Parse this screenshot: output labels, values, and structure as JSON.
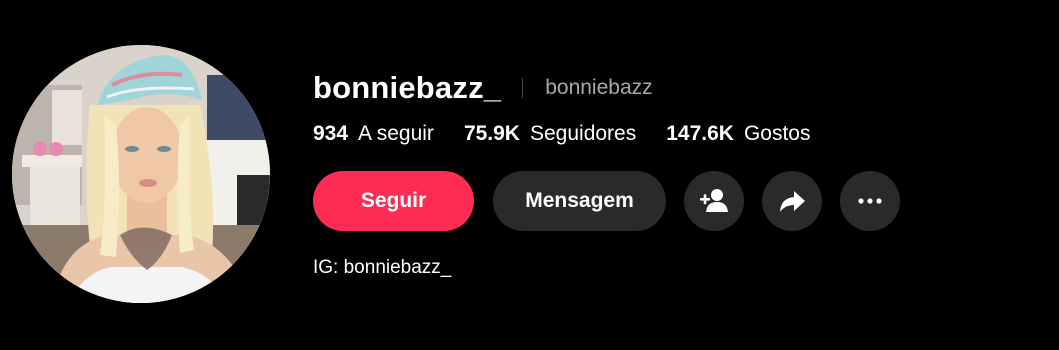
{
  "profile": {
    "display_name": "bonniebazz_",
    "username": "bonniebazz",
    "bio": "IG: bonniebazz_"
  },
  "stats": {
    "following": {
      "value": "934",
      "label": "A seguir"
    },
    "followers": {
      "value": "75.9K",
      "label": "Seguidores"
    },
    "likes": {
      "value": "147.6K",
      "label": "Gostos"
    }
  },
  "actions": {
    "follow_label": "Seguir",
    "message_label": "Mensagem",
    "add_friend_icon": "add-user-icon",
    "share_icon": "share-arrow-icon",
    "more_icon": "more-horizontal-icon"
  },
  "colors": {
    "background": "#000000",
    "primary": "#fe2c55",
    "secondary_button": "#2a2a2a",
    "muted_text": "#a8a8a8"
  }
}
